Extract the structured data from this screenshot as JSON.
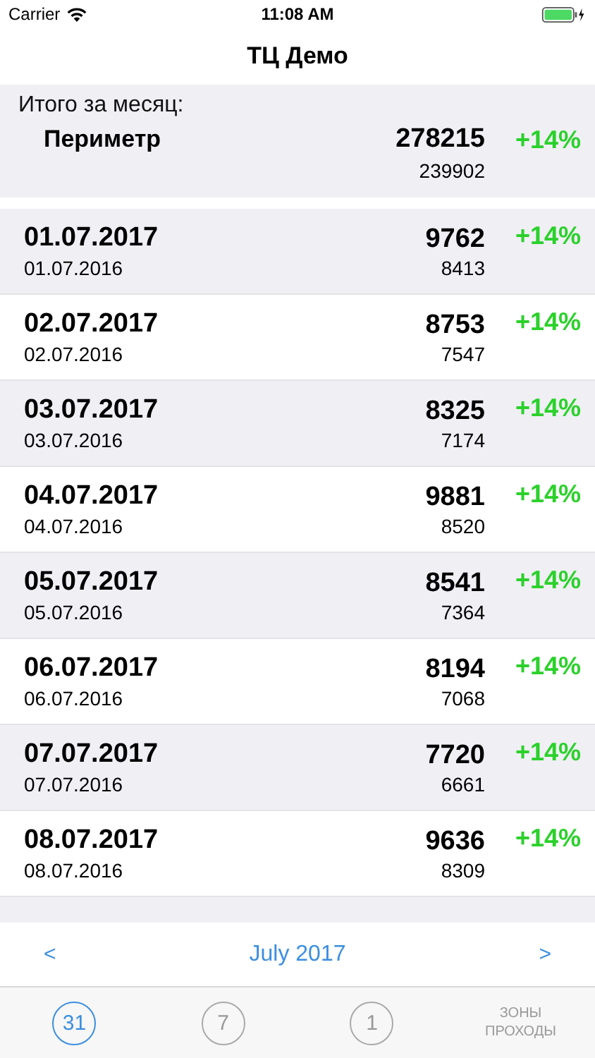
{
  "status_bar": {
    "carrier": "Carrier",
    "time": "11:08 AM"
  },
  "nav": {
    "title": "ТЦ Демо"
  },
  "summary": {
    "label": "Итого за месяц:",
    "name": "Периметр",
    "value": "278215",
    "change": "+14%",
    "previous": "239902"
  },
  "rows": [
    {
      "date": "01.07.2017",
      "prev_date": "01.07.2016",
      "value": "9762",
      "previous": "8413",
      "change": "+14%"
    },
    {
      "date": "02.07.2017",
      "prev_date": "02.07.2016",
      "value": "8753",
      "previous": "7547",
      "change": "+14%"
    },
    {
      "date": "03.07.2017",
      "prev_date": "03.07.2016",
      "value": "8325",
      "previous": "7174",
      "change": "+14%"
    },
    {
      "date": "04.07.2017",
      "prev_date": "04.07.2016",
      "value": "9881",
      "previous": "8520",
      "change": "+14%"
    },
    {
      "date": "05.07.2017",
      "prev_date": "05.07.2016",
      "value": "8541",
      "previous": "7364",
      "change": "+14%"
    },
    {
      "date": "06.07.2017",
      "prev_date": "06.07.2016",
      "value": "8194",
      "previous": "7068",
      "change": "+14%"
    },
    {
      "date": "07.07.2017",
      "prev_date": "07.07.2016",
      "value": "7720",
      "previous": "6661",
      "change": "+14%"
    },
    {
      "date": "08.07.2017",
      "prev_date": "08.07.2016",
      "value": "9636",
      "previous": "8309",
      "change": "+14%"
    }
  ],
  "period": {
    "prev": "<",
    "label": "July 2017",
    "next": ">"
  },
  "tabs": [
    {
      "kind": "circle",
      "label": "31",
      "selected": true
    },
    {
      "kind": "circle",
      "label": "7",
      "selected": false
    },
    {
      "kind": "circle",
      "label": "1",
      "selected": false
    },
    {
      "kind": "text",
      "label": "ЗОНЫ ПРОХОДЫ",
      "selected": false
    }
  ]
}
